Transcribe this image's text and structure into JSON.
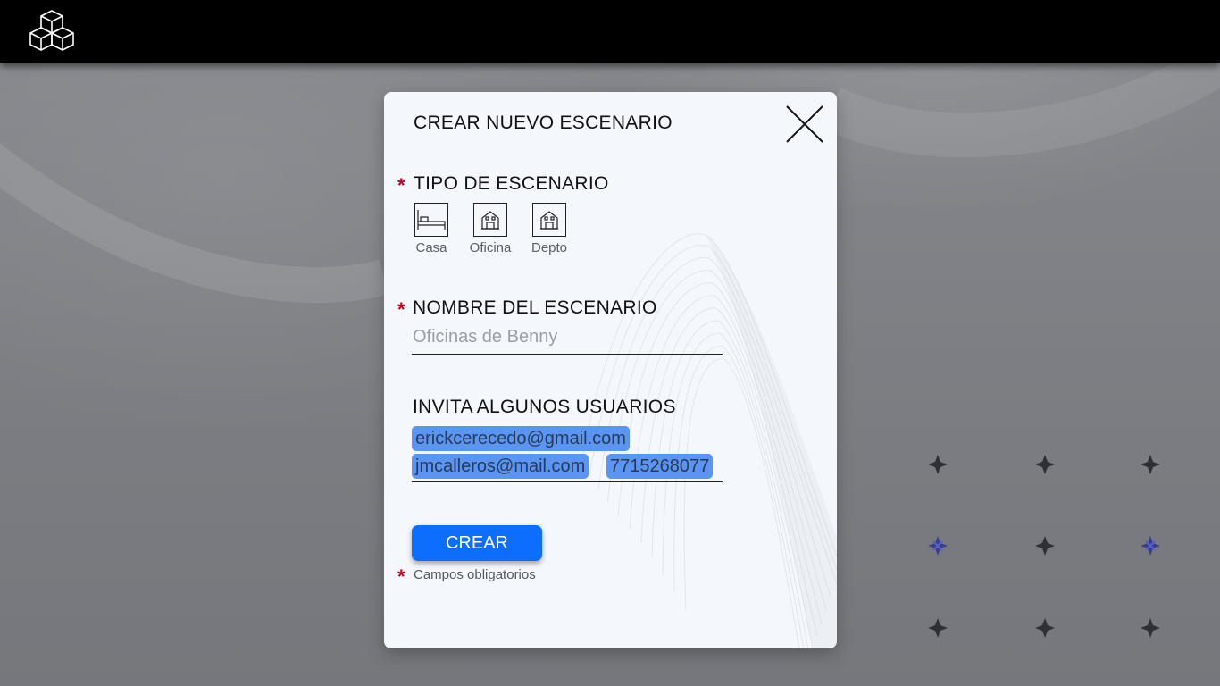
{
  "header": {
    "logo_icon": "cubes-logo-icon"
  },
  "modal": {
    "title": "CREAR NUEVO ESCENARIO",
    "close_icon": "close-icon",
    "required_mark": "*",
    "scenario_type": {
      "label": "TIPO DE ESCENARIO",
      "options": [
        {
          "label": "Casa",
          "icon": "bed-icon"
        },
        {
          "label": "Oficina",
          "icon": "building-icon"
        },
        {
          "label": "Depto",
          "icon": "building-icon"
        }
      ]
    },
    "scenario_name": {
      "label": "NOMBRE DEL ESCENARIO",
      "placeholder": "Oficinas de Benny",
      "value": ""
    },
    "invite": {
      "label": "INVITA ALGUNOS USUARIOS",
      "chips": [
        "erickcerecedo@gmail.com",
        "jmcalleros@mail.com",
        "7715268077"
      ]
    },
    "create_button": "CREAR",
    "required_note": "Campos obligatorios"
  },
  "colors": {
    "accent": "#0d6efd",
    "chip": "#5b95f3",
    "required": "#c4001a",
    "topbar": "#000000"
  }
}
